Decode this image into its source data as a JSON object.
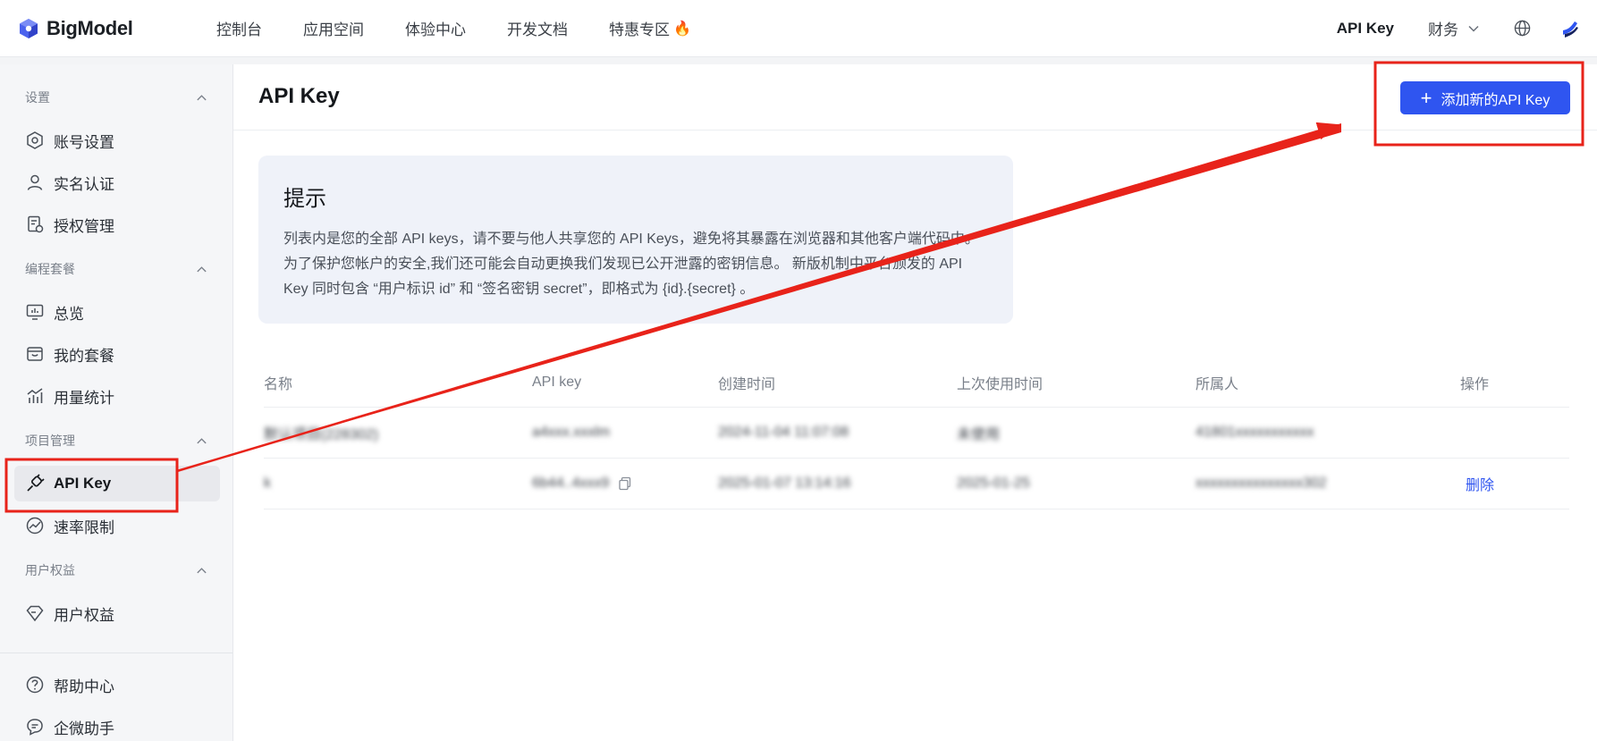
{
  "brand": {
    "name": "BigModel"
  },
  "nav": {
    "items": [
      "控制台",
      "应用空间",
      "体验中心",
      "开发文档",
      "特惠专区"
    ],
    "fire_glyph": "🔥",
    "api_key": "API Key",
    "finance": "财务"
  },
  "sidebar": {
    "groups": [
      {
        "title": "设置",
        "items": [
          "账号设置",
          "实名认证",
          "授权管理"
        ]
      },
      {
        "title": "编程套餐",
        "items": [
          "总览",
          "我的套餐",
          "用量统计"
        ]
      },
      {
        "title": "项目管理",
        "items": [
          "API Key",
          "速率限制"
        ]
      },
      {
        "title": "用户权益",
        "items": [
          "用户权益"
        ]
      }
    ],
    "bottom_items": [
      "帮助中心",
      "企微助手"
    ],
    "active": "API Key"
  },
  "page": {
    "title": "API Key",
    "add_button": "添加新的API Key"
  },
  "tip": {
    "title": "提示",
    "body": "列表内是您的全部 API keys，请不要与他人共享您的 API Keys，避免将其暴露在浏览器和其他客户端代码中。为了保护您帐户的安全,我们还可能会自动更换我们发现已公开泄露的密钥信息。 新版机制中平台颁发的 API Key 同时包含 “用户标识 id” 和 “签名密钥 secret”，即格式为 {id}.{secret} 。"
  },
  "table": {
    "headers": [
      "名称",
      "API key",
      "创建时间",
      "上次使用时间",
      "所属人",
      "操作"
    ],
    "rows": [
      {
        "name": "默认项目(228302)",
        "key": "a4xxx.xxxlm",
        "created": "2024-11-04 11:07:08",
        "last_used": "未使用",
        "owner": "41801xxxxxxxxxxx",
        "action": ""
      },
      {
        "name": "k",
        "key": "6b44..4xxx9",
        "created": "2025-01-07 13:14:16",
        "last_used": "2025-01-25",
        "owner": "xxxxxxxxxxxxxxx302",
        "action": "删除"
      }
    ]
  },
  "colors": {
    "primary": "#2f55f0",
    "annotation": "#e8231a"
  }
}
